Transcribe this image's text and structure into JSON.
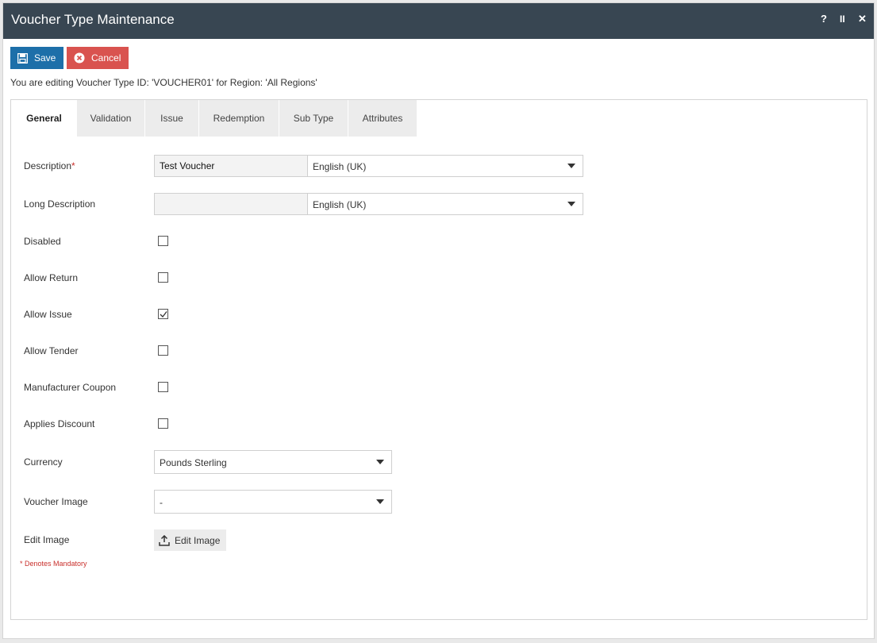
{
  "window": {
    "title": "Voucher Type Maintenance",
    "help_label": "?",
    "pause_label": "II",
    "close_label": "✕"
  },
  "toolbar": {
    "save_label": "Save",
    "cancel_label": "Cancel"
  },
  "info": {
    "editing_text": "You are editing Voucher Type ID: 'VOUCHER01' for Region: 'All Regions'"
  },
  "tabs": [
    {
      "label": "General",
      "active": true
    },
    {
      "label": "Validation",
      "active": false
    },
    {
      "label": "Issue",
      "active": false
    },
    {
      "label": "Redemption",
      "active": false
    },
    {
      "label": "Sub Type",
      "active": false
    },
    {
      "label": "Attributes",
      "active": false
    }
  ],
  "form": {
    "description": {
      "label": "Description",
      "required_marker": "*",
      "value": "Test Voucher",
      "language": "English (UK)"
    },
    "long_description": {
      "label": "Long Description",
      "value": "",
      "language": "English (UK)"
    },
    "disabled": {
      "label": "Disabled",
      "checked": false
    },
    "allow_return": {
      "label": "Allow Return",
      "checked": false
    },
    "allow_issue": {
      "label": "Allow Issue",
      "checked": true
    },
    "allow_tender": {
      "label": "Allow Tender",
      "checked": false
    },
    "manufacturer_coupon": {
      "label": "Manufacturer Coupon",
      "checked": false
    },
    "applies_discount": {
      "label": "Applies Discount",
      "checked": false
    },
    "currency": {
      "label": "Currency",
      "value": "Pounds Sterling"
    },
    "voucher_image": {
      "label": "Voucher Image",
      "value": "-"
    },
    "edit_image": {
      "label": "Edit Image",
      "button_label": "Edit Image"
    }
  },
  "footer": {
    "mandatory_note": "* Denotes Mandatory"
  },
  "colors": {
    "titlebar": "#384652",
    "save": "#1d6fa9",
    "cancel": "#d9534f",
    "required": "#c9302c"
  }
}
